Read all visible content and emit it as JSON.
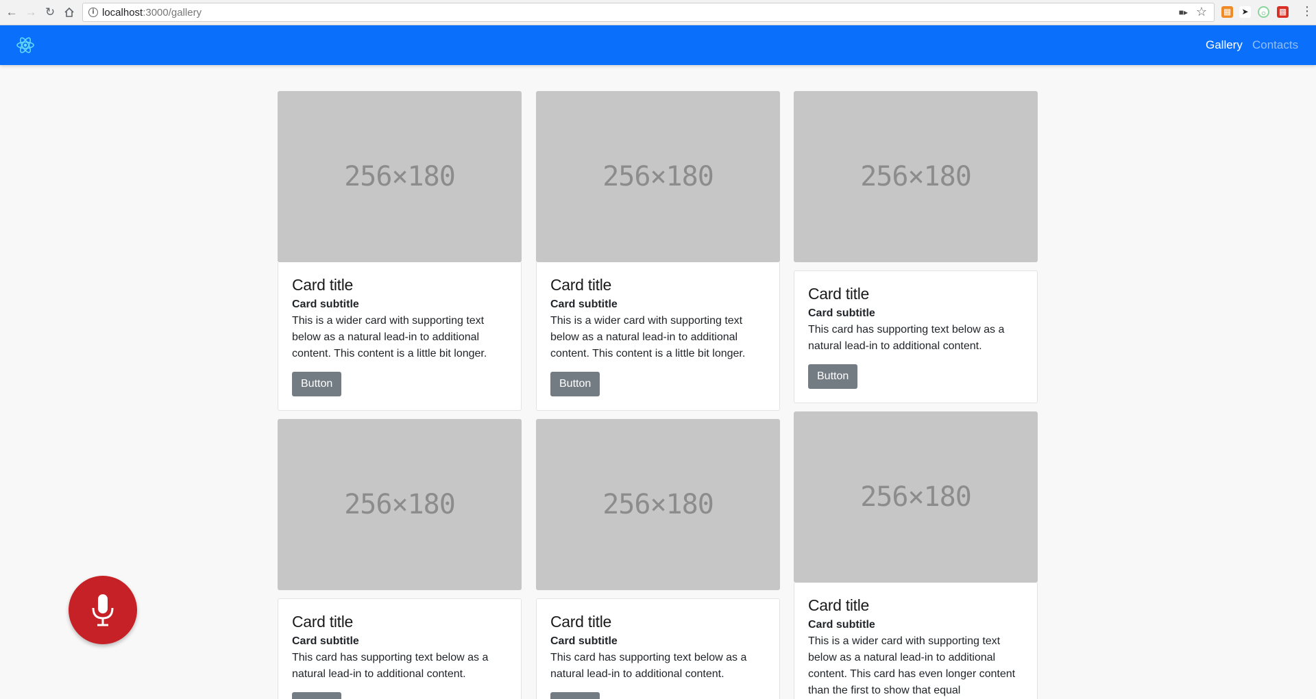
{
  "browser": {
    "url_host": "localhost",
    "url_path": ":3000/gallery"
  },
  "navbar": {
    "brand": "react-logo-icon",
    "brand_color": "#61dafb",
    "bg_color": "#0a6ffb",
    "links": [
      {
        "label": "Gallery",
        "active": true
      },
      {
        "label": "Contacts",
        "active": false
      }
    ]
  },
  "gallery": {
    "placeholder": "256×180",
    "button_label": "Button",
    "cards": [
      {
        "title": "Card title",
        "subtitle": "Card subtitle",
        "text": "This is a wider card with supporting text below as a natural lead-in to additional content. This content is a little bit longer."
      },
      {
        "title": "Card title",
        "subtitle": "Card subtitle",
        "text": "This is a wider card with supporting text below as a natural lead-in to additional content. This content is a little bit longer."
      },
      {
        "title": "Card title",
        "subtitle": "Card subtitle",
        "text": "This card has supporting text below as a natural lead-in to additional content."
      },
      {
        "title": "Card title",
        "subtitle": "Card subtitle",
        "text": "This card has supporting text below as a natural lead-in to additional content."
      },
      {
        "title": "Card title",
        "subtitle": "Card subtitle",
        "text": "This card has supporting text below as a natural lead-in to additional content."
      },
      {
        "title": "Card title",
        "subtitle": "Card subtitle",
        "text": "This is a wider card with supporting text below as a natural lead-in to additional content. This card has even longer content than the first to show that equal"
      }
    ]
  },
  "mic_button": {
    "icon": "microphone-icon",
    "color": "#c62126"
  }
}
